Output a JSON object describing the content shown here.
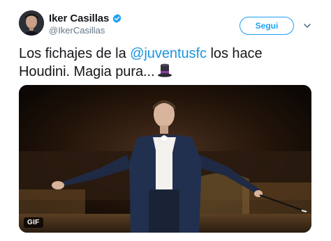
{
  "author": {
    "display_name": "Iker Casillas",
    "handle": "@IkerCasillas",
    "verified": true
  },
  "follow_button": {
    "label": "Segui"
  },
  "menu": {
    "icon": "chevron-down-icon"
  },
  "tweet": {
    "text_before_mention": "Los fichajes de la ",
    "mention": "@juventusfc",
    "text_after_mention": " los hace Houdini. Magia pura...",
    "emoji": "top-hat-icon"
  },
  "media": {
    "badge": "GIF",
    "description_icon": "magician-gif-image"
  },
  "colors": {
    "accent": "#1da1f2",
    "mention": "#1b95e0",
    "secondary_text": "#657786"
  }
}
